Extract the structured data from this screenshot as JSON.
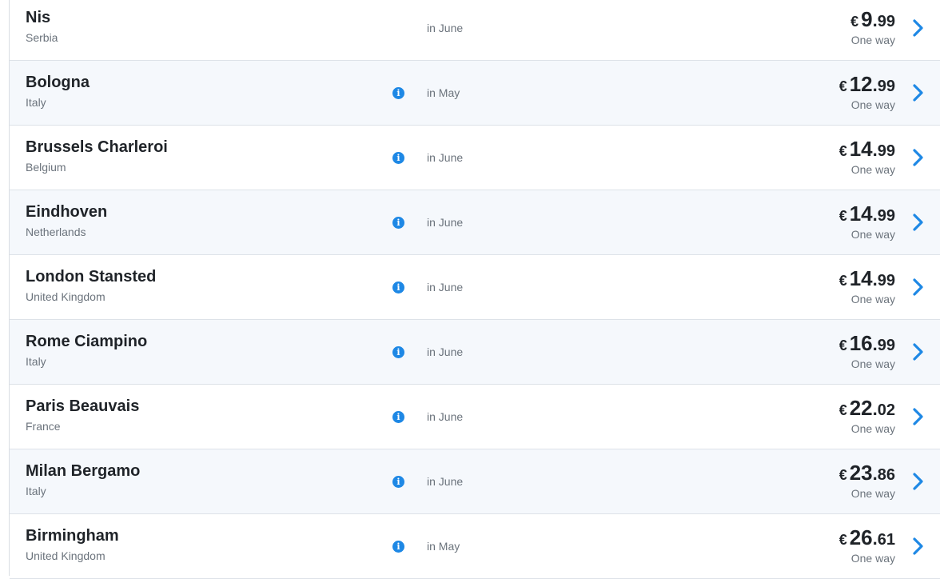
{
  "colors": {
    "accent": "#1e88e5",
    "text_primary": "#1f2328",
    "text_secondary": "#6b737c",
    "row_alt_bg": "#f5f8fc"
  },
  "icons": {
    "info": "info-icon",
    "chevron": "chevron-right-icon"
  },
  "flights": [
    {
      "city": "Nis",
      "country": "Serbia",
      "month": "in June",
      "currency": "€",
      "price_int": "9",
      "price_dec": "99",
      "fare_type": "One way",
      "has_info": false
    },
    {
      "city": "Bologna",
      "country": "Italy",
      "month": "in May",
      "currency": "€",
      "price_int": "12",
      "price_dec": "99",
      "fare_type": "One way",
      "has_info": true
    },
    {
      "city": "Brussels Charleroi",
      "country": "Belgium",
      "month": "in June",
      "currency": "€",
      "price_int": "14",
      "price_dec": "99",
      "fare_type": "One way",
      "has_info": true
    },
    {
      "city": "Eindhoven",
      "country": "Netherlands",
      "month": "in June",
      "currency": "€",
      "price_int": "14",
      "price_dec": "99",
      "fare_type": "One way",
      "has_info": true
    },
    {
      "city": "London Stansted",
      "country": "United Kingdom",
      "month": "in June",
      "currency": "€",
      "price_int": "14",
      "price_dec": "99",
      "fare_type": "One way",
      "has_info": true
    },
    {
      "city": "Rome Ciampino",
      "country": "Italy",
      "month": "in June",
      "currency": "€",
      "price_int": "16",
      "price_dec": "99",
      "fare_type": "One way",
      "has_info": true
    },
    {
      "city": "Paris Beauvais",
      "country": "France",
      "month": "in June",
      "currency": "€",
      "price_int": "22",
      "price_dec": "02",
      "fare_type": "One way",
      "has_info": true
    },
    {
      "city": "Milan Bergamo",
      "country": "Italy",
      "month": "in June",
      "currency": "€",
      "price_int": "23",
      "price_dec": "86",
      "fare_type": "One way",
      "has_info": true
    },
    {
      "city": "Birmingham",
      "country": "United Kingdom",
      "month": "in May",
      "currency": "€",
      "price_int": "26",
      "price_dec": "61",
      "fare_type": "One way",
      "has_info": true
    }
  ]
}
